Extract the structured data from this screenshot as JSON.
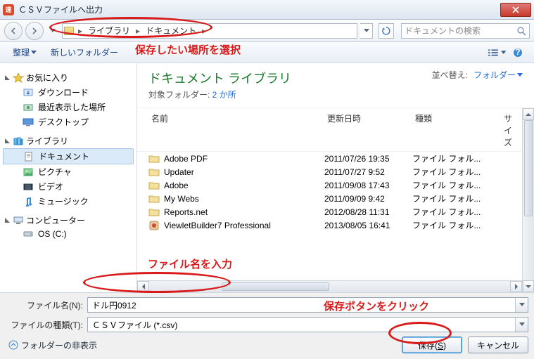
{
  "title": "ＣＳＶファイルへ出力",
  "breadcrumb": {
    "seg1": "ライブラリ",
    "seg2": "ドキュメント"
  },
  "search": {
    "placeholder": "ドキュメントの検索"
  },
  "toolbar": {
    "organize": "整理",
    "newfolder": "新しいフォルダー"
  },
  "annotation": {
    "location": "保存したい場所を選択",
    "filename": "ファイル名を入力",
    "save": "保存ボタンをクリック"
  },
  "sidebar": {
    "favorites": {
      "label": "お気に入り",
      "downloads": "ダウンロード",
      "recent": "最近表示した場所",
      "desktop": "デスクトップ"
    },
    "libraries": {
      "label": "ライブラリ",
      "documents": "ドキュメント",
      "pictures": "ピクチャ",
      "videos": "ビデオ",
      "music": "ミュージック"
    },
    "computer": {
      "label": "コンピューター",
      "osc": "OS (C:)"
    }
  },
  "mainhead": {
    "title": "ドキュメント ライブラリ",
    "sub_prefix": "対象フォルダー: ",
    "sub_link": "2 か所",
    "sort_label": "並べ替え:",
    "sort_value": "フォルダー"
  },
  "columns": {
    "name": "名前",
    "date": "更新日時",
    "type": "種類",
    "size": "サイズ"
  },
  "files": [
    {
      "name": "Adobe PDF",
      "date": "2011/07/26 19:35",
      "type": "ファイル フォル...",
      "icon": "folder"
    },
    {
      "name": "Updater",
      "date": "2011/07/27 9:52",
      "type": "ファイル フォル...",
      "icon": "folder"
    },
    {
      "name": "Adobe",
      "date": "2011/09/08 17:43",
      "type": "ファイル フォル...",
      "icon": "folder"
    },
    {
      "name": "My Webs",
      "date": "2011/09/09 9:42",
      "type": "ファイル フォル...",
      "icon": "folder"
    },
    {
      "name": "Reports.net",
      "date": "2012/08/28 11:31",
      "type": "ファイル フォル...",
      "icon": "folder"
    },
    {
      "name": "ViewletBuilder7 Professional",
      "date": "2013/08/05 16:41",
      "type": "ファイル フォル...",
      "icon": "app"
    }
  ],
  "form": {
    "filename_label": "ファイル名(N):",
    "filename_value": "ドル円0912",
    "filetype_label": "ファイルの種類(T):",
    "filetype_value": "ＣＳＶファイル (*.csv)"
  },
  "footer": {
    "hide_folders": "フォルダーの非表示",
    "save": "保存(S)",
    "cancel": "キャンセル"
  }
}
